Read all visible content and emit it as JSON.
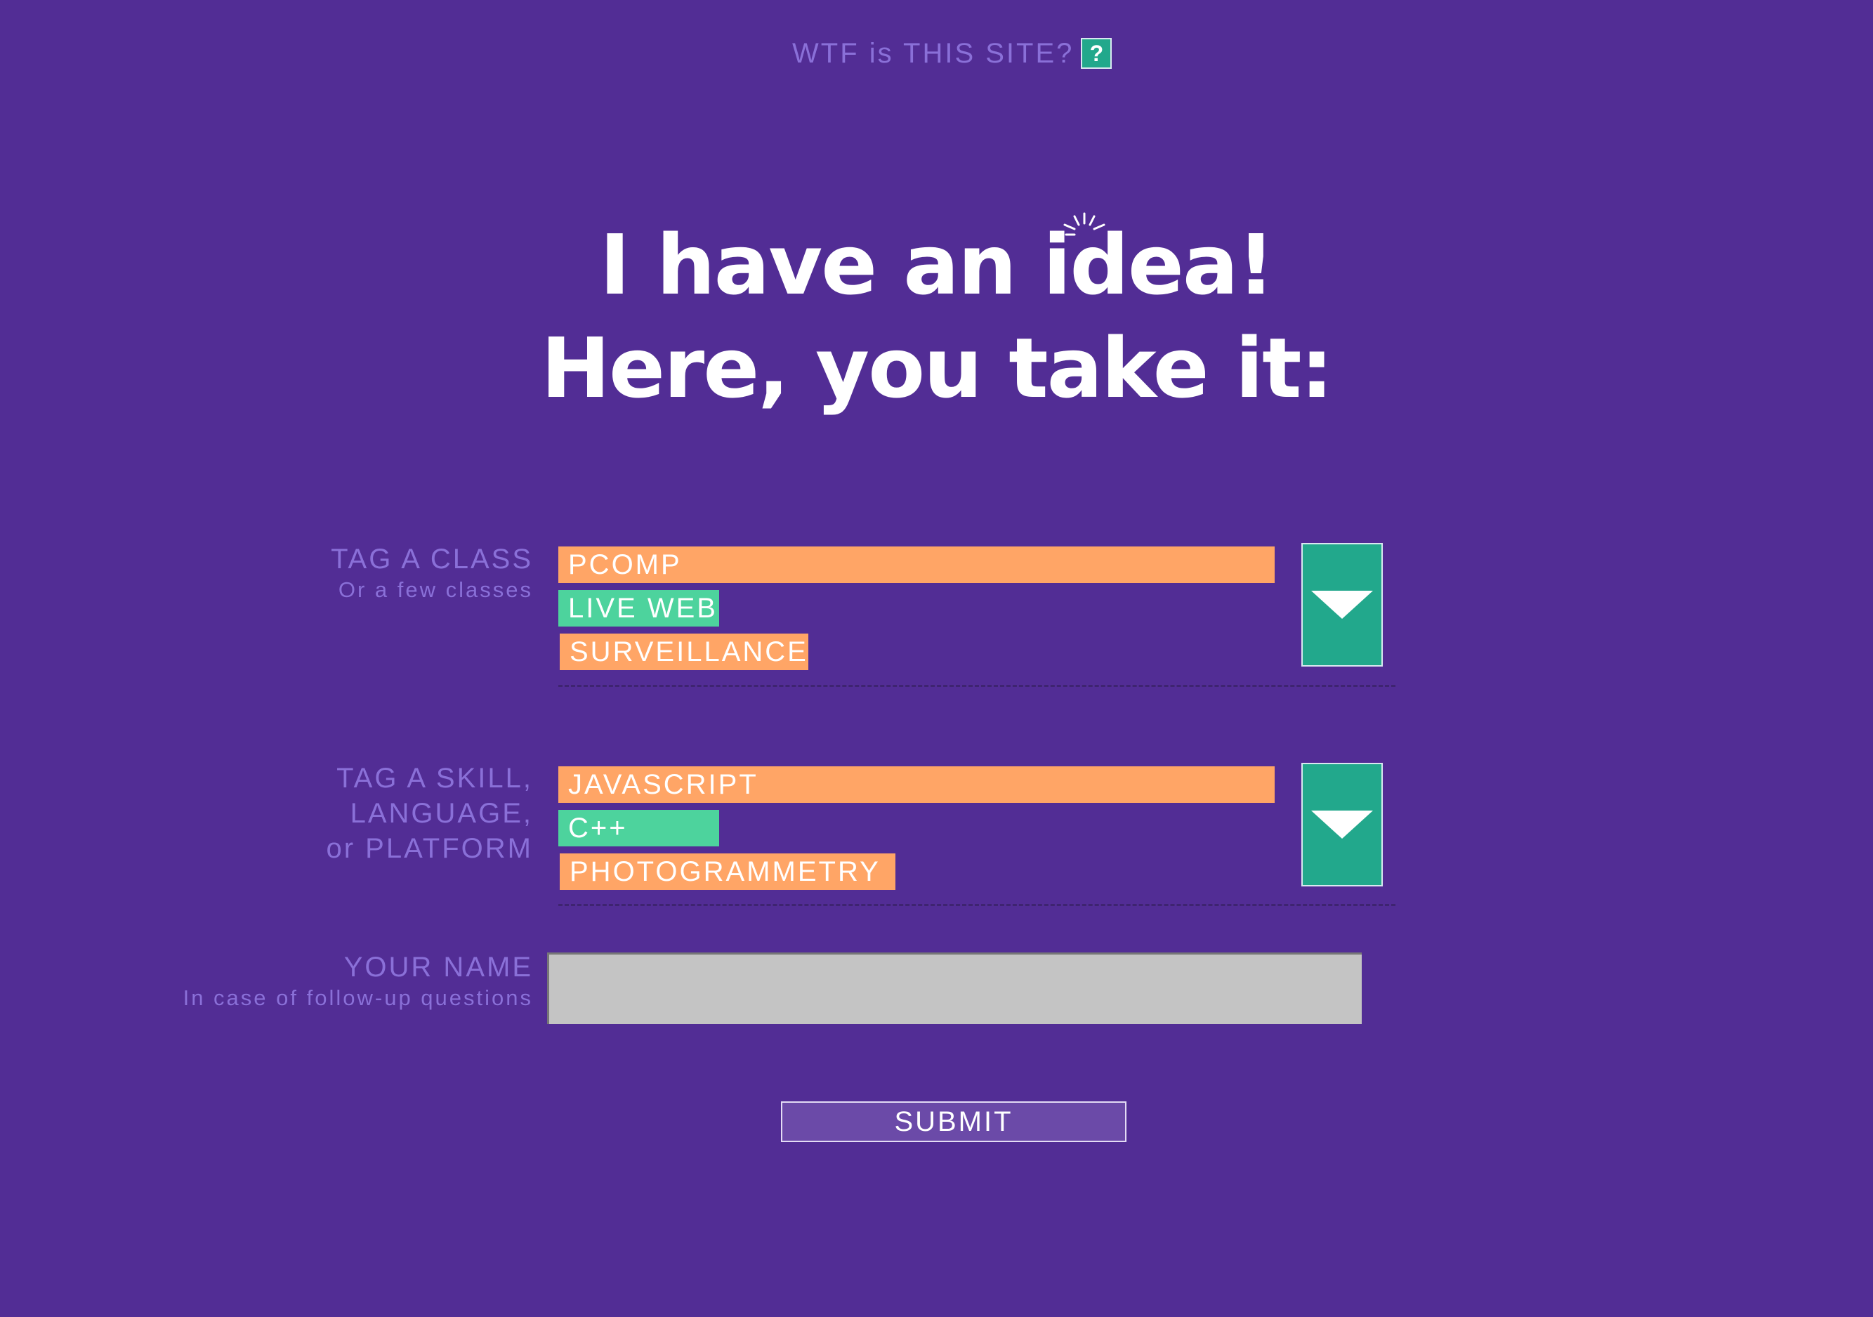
{
  "header": {
    "link_text": "WTF is THIS SITE?",
    "help_icon_glyph": "?"
  },
  "headline": {
    "line1": "I have an idea!",
    "line2": "Here, you take it:"
  },
  "class_field": {
    "label": "TAG A CLASS",
    "sublabel": "Or a few classes",
    "tags": [
      "PCOMP",
      "LIVE WEB",
      "SURVEILLANCE"
    ]
  },
  "skill_field": {
    "label_line1": "TAG A SKILL,",
    "label_line2": "LANGUAGE,",
    "label_line3": "or PLATFORM",
    "tags": [
      "JAVASCRIPT",
      "C++",
      "PHOTOGRAMMETRY"
    ]
  },
  "name_field": {
    "label": "YOUR NAME",
    "sublabel": "In case of follow-up questions",
    "value": ""
  },
  "submit_label": "SUBMIT",
  "colors": {
    "background": "#522d95",
    "muted_label": "#8a70d8",
    "tag_orange": "#ffa566",
    "tag_green": "#4dd39d",
    "dropdown_teal": "#22a88c"
  }
}
